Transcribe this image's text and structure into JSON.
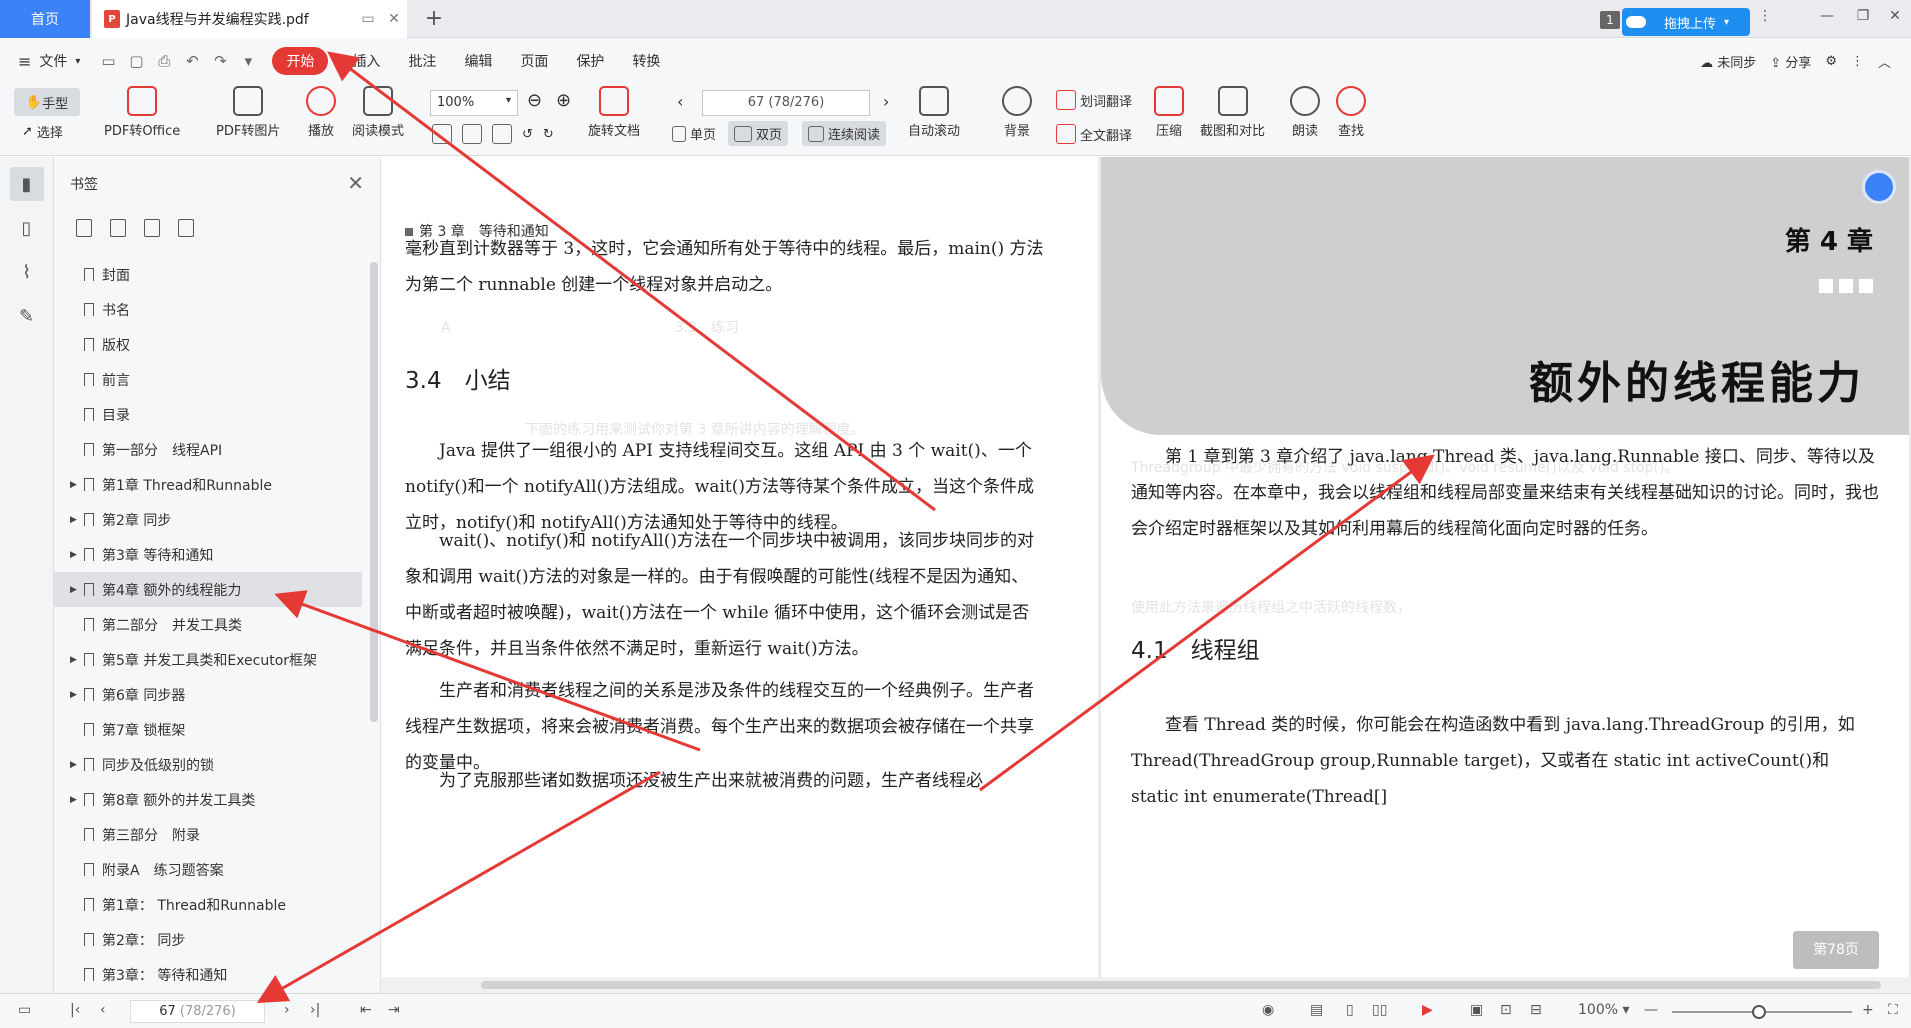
{
  "tabs": {
    "home": "首页",
    "document": "Java线程与并发编程实践.pdf",
    "badge": "1",
    "upload": "拖拽上传"
  },
  "menu": {
    "file": "文件",
    "start": "开始",
    "items": [
      "插入",
      "批注",
      "编辑",
      "页面",
      "保护",
      "转换"
    ],
    "sync": "未同步",
    "share": "分享"
  },
  "ribbon": {
    "hand": "手型",
    "select": "选择",
    "pdf_to_office": "PDF转Office",
    "pdf_to_image": "PDF转图片",
    "play": "播放",
    "read_mode": "阅读模式",
    "zoom": "100%",
    "page_input": "67 (78/276)",
    "rotate": "旋转文档",
    "single": "单页",
    "double": "双页",
    "continuous": "连续阅读",
    "auto_scroll": "自动滚动",
    "background": "背景",
    "word_translate": "划词翻译",
    "full_translate": "全文翻译",
    "compress": "压缩",
    "screenshot_compare": "截图和对比",
    "read_aloud": "朗读",
    "search": "查找"
  },
  "bookmarks": {
    "title": "书签",
    "items": [
      {
        "label": "封面",
        "expandable": false
      },
      {
        "label": "书名",
        "expandable": false
      },
      {
        "label": "版权",
        "expandable": false
      },
      {
        "label": "前言",
        "expandable": false
      },
      {
        "label": "目录",
        "expandable": false
      },
      {
        "label": "第一部分　线程API",
        "expandable": false
      },
      {
        "label": "第1章 Thread和Runnable",
        "expandable": true
      },
      {
        "label": "第2章 同步",
        "expandable": true
      },
      {
        "label": "第3章 等待和通知",
        "expandable": true
      },
      {
        "label": "第4章 额外的线程能力",
        "expandable": true,
        "selected": true
      },
      {
        "label": "第二部分　并发工具类",
        "expandable": false
      },
      {
        "label": "第5章 并发工具类和Executor框架",
        "expandable": true
      },
      {
        "label": "第6章 同步器",
        "expandable": true
      },
      {
        "label": "第7章 锁框架",
        "expandable": false
      },
      {
        "label": "同步及低级别的锁",
        "expandable": true
      },
      {
        "label": "第8章 额外的并发工具类",
        "expandable": true
      },
      {
        "label": "第三部分　附录",
        "expandable": false
      },
      {
        "label": "附录A　练习题答案",
        "expandable": false
      },
      {
        "label": "第1章： Thread和Runnable",
        "expandable": false
      },
      {
        "label": "第2章： 同步",
        "expandable": false
      },
      {
        "label": "第3章： 等待和通知",
        "expandable": false
      }
    ]
  },
  "left_page": {
    "running_head": "第 3 章　等待和通知",
    "para1": "毫秒直到计数器等于 3，这时，它会通知所有处于等待中的线程。最后，main() 方法为第二个 runnable 创建一个线程对象并启动之。",
    "section": "3.4　小结",
    "para2": "Java 提供了一组很小的 API 支持线程间交互。这组 API 由 3 个 wait()、一个 notify()和一个 notifyAll()方法组成。wait()方法等待某个条件成立，当这个条件成立时，notify()和 notifyAll()方法通知处于等待中的线程。",
    "para3": "wait()、notify()和 notifyAll()方法在一个同步块中被调用，该同步块同步的对象和调用 wait()方法的对象是一样的。由于有假唤醒的可能性(线程不是因为通知、中断或者超时被唤醒)，wait()方法在一个 while 循环中使用，这个循环会测试是否满足条件，并且当条件依然不满足时，重新运行 wait()方法。",
    "para4": "生产者和消费者线程之间的关系是涉及条件的线程交互的一个经典例子。生产者线程产生数据项，将来会被消费者消费。每个生产出来的数据项会被存储在一个共享的变量中。",
    "para5": "为了克服那些诸如数据项还没被生产出来就被消费的问题，生产者线程必"
  },
  "right_page": {
    "chapter_no": "第 4 章",
    "chapter_title": "额外的线程能力",
    "para1": "第 1 章到第 3 章介绍了 java.lang.Thread 类、java.lang.Runnable 接口、同步、等待以及通知等内容。在本章中，我会以线程组和线程局部变量来结束有关线程基础知识的讨论。同时，我也会介绍定时器框架以及其如何利用幕后的线程简化面向定时器的任务。",
    "section": "4.1　线程组",
    "para2": "查看 Thread 类的时候，你可能会在构造函数中看到 java.lang.ThreadGroup 的引用，如 Thread(ThreadGroup group,Runnable target)，又或者在 static int activeCount()和 static int enumerate(Thread[]",
    "page_pill": "第78页"
  },
  "status": {
    "page_current": "67",
    "page_total": " (78/276)",
    "zoom": "100%"
  },
  "colors": {
    "accent": "#3b82f6",
    "start_tab": "#e53935",
    "arrow": "#e53935"
  }
}
